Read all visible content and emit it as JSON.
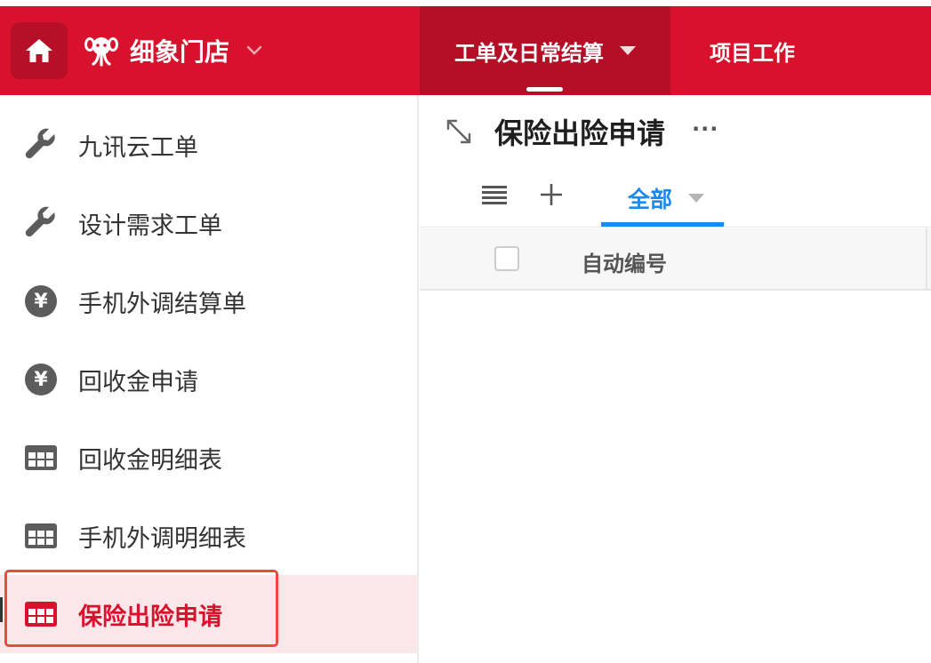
{
  "topbar": {
    "brand_name": "细象门店",
    "nav": [
      {
        "label": "工单及日常结算",
        "active": true
      },
      {
        "label": "项目工作",
        "active": false
      }
    ]
  },
  "sidebar": {
    "items": [
      {
        "label": "九讯云工单",
        "icon": "wrench-icon"
      },
      {
        "label": "设计需求工单",
        "icon": "wrench-icon"
      },
      {
        "label": "手机外调结算单",
        "icon": "yen-icon"
      },
      {
        "label": "回收金申请",
        "icon": "yen-icon"
      },
      {
        "label": "回收金明细表",
        "icon": "table-grid-icon"
      },
      {
        "label": "手机外调明细表",
        "icon": "table-grid-icon"
      },
      {
        "label": "保险出险申请",
        "icon": "table-grid-icon",
        "active": true
      }
    ],
    "yen_symbol": "¥"
  },
  "main": {
    "title": "保险出险申请",
    "more": "···",
    "tabs": [
      {
        "label": "全部",
        "active": true
      }
    ],
    "table": {
      "columns": [
        "自动编号"
      ]
    }
  },
  "colors": {
    "brand_red": "#d8112d",
    "nav_active_bg": "#b60e26",
    "active_tab_blue": "#1b8af0",
    "sidebar_active_bg": "#fbe6e9"
  }
}
